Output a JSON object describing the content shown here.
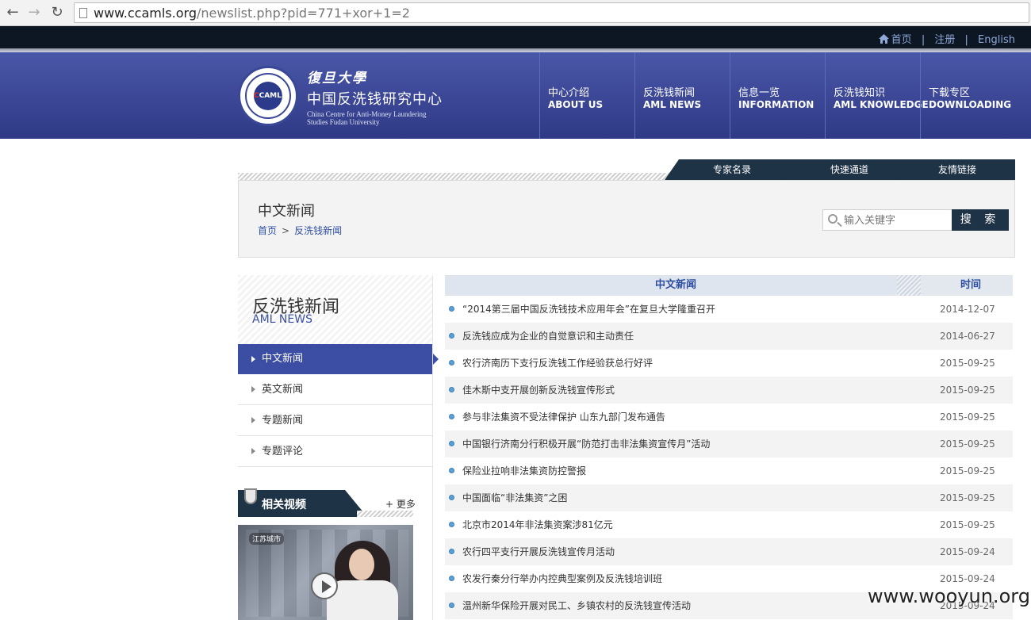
{
  "browser": {
    "url_host": "www.ccamls.org",
    "url_path": "/newslist.php?pid=771+xor+1=2"
  },
  "top_links": {
    "home": "首页",
    "register": "注册",
    "english": "English",
    "sep": "|"
  },
  "logo": {
    "script": "復旦大學",
    "cn_name": "中国反洗钱研究中心",
    "en_line1": "China Centre for Anti-Money Laundering",
    "en_line2": "Studies Fudan University",
    "seal_text": "CAMLS"
  },
  "main_nav": [
    {
      "cn": "中心介绍",
      "en": "ABOUT US"
    },
    {
      "cn": "反洗钱新闻",
      "en": "AML NEWS"
    },
    {
      "cn": "信息一览",
      "en": "INFORMATION"
    },
    {
      "cn": "反洗钱知识",
      "en": "AML KNOWLEDGE"
    },
    {
      "cn": "下载专区",
      "en": "DOWNLOADING"
    }
  ],
  "quick_tabs": [
    "专家名录",
    "快速通道",
    "友情链接"
  ],
  "page": {
    "title": "中文新闻",
    "breadcrumb_home": "首页",
    "breadcrumb_gt": ">",
    "breadcrumb_current": "反洗钱新闻"
  },
  "search": {
    "placeholder": "输入关键字",
    "button": "搜 索"
  },
  "sidebar": {
    "title_cn": "反洗钱新闻",
    "title_en": "AML NEWS",
    "items": [
      "中文新闻",
      "英文新闻",
      "专题新闻",
      "专题评论"
    ]
  },
  "video": {
    "title": "相关视频",
    "more": "+ 更多",
    "channel": "江苏城市"
  },
  "news_header": {
    "title": "中文新闻",
    "time": "时间"
  },
  "news": [
    {
      "title": "“2014第三届中国反洗钱技术应用年会”在复旦大学隆重召开",
      "date": "2014-12-07"
    },
    {
      "title": "反洗钱应成为企业的自觉意识和主动责任",
      "date": "2014-06-27"
    },
    {
      "title": "农行济南历下支行反洗钱工作经验获总行好评",
      "date": "2015-09-25"
    },
    {
      "title": "佳木斯中支开展创新反洗钱宣传形式",
      "date": "2015-09-25"
    },
    {
      "title": "参与非法集资不受法律保护 山东九部门发布通告",
      "date": "2015-09-25"
    },
    {
      "title": "中国银行济南分行积极开展“防范打击非法集资宣传月”活动",
      "date": "2015-09-25"
    },
    {
      "title": "保险业拉响非法集资防控警报",
      "date": "2015-09-25"
    },
    {
      "title": "中国面临“非法集资”之困",
      "date": "2015-09-25"
    },
    {
      "title": "北京市2014年非法集资案涉81亿元",
      "date": "2015-09-25"
    },
    {
      "title": "农行四平支行开展反洗钱宣传月活动",
      "date": "2015-09-24"
    },
    {
      "title": "农发行秦分行举办内控典型案例及反洗钱培训班",
      "date": "2015-09-24"
    },
    {
      "title": "温州新华保险开展对民工、乡镇农村的反洗钱宣传活动",
      "date": "2015-09-24"
    }
  ],
  "watermark": "www.wooyun.org"
}
